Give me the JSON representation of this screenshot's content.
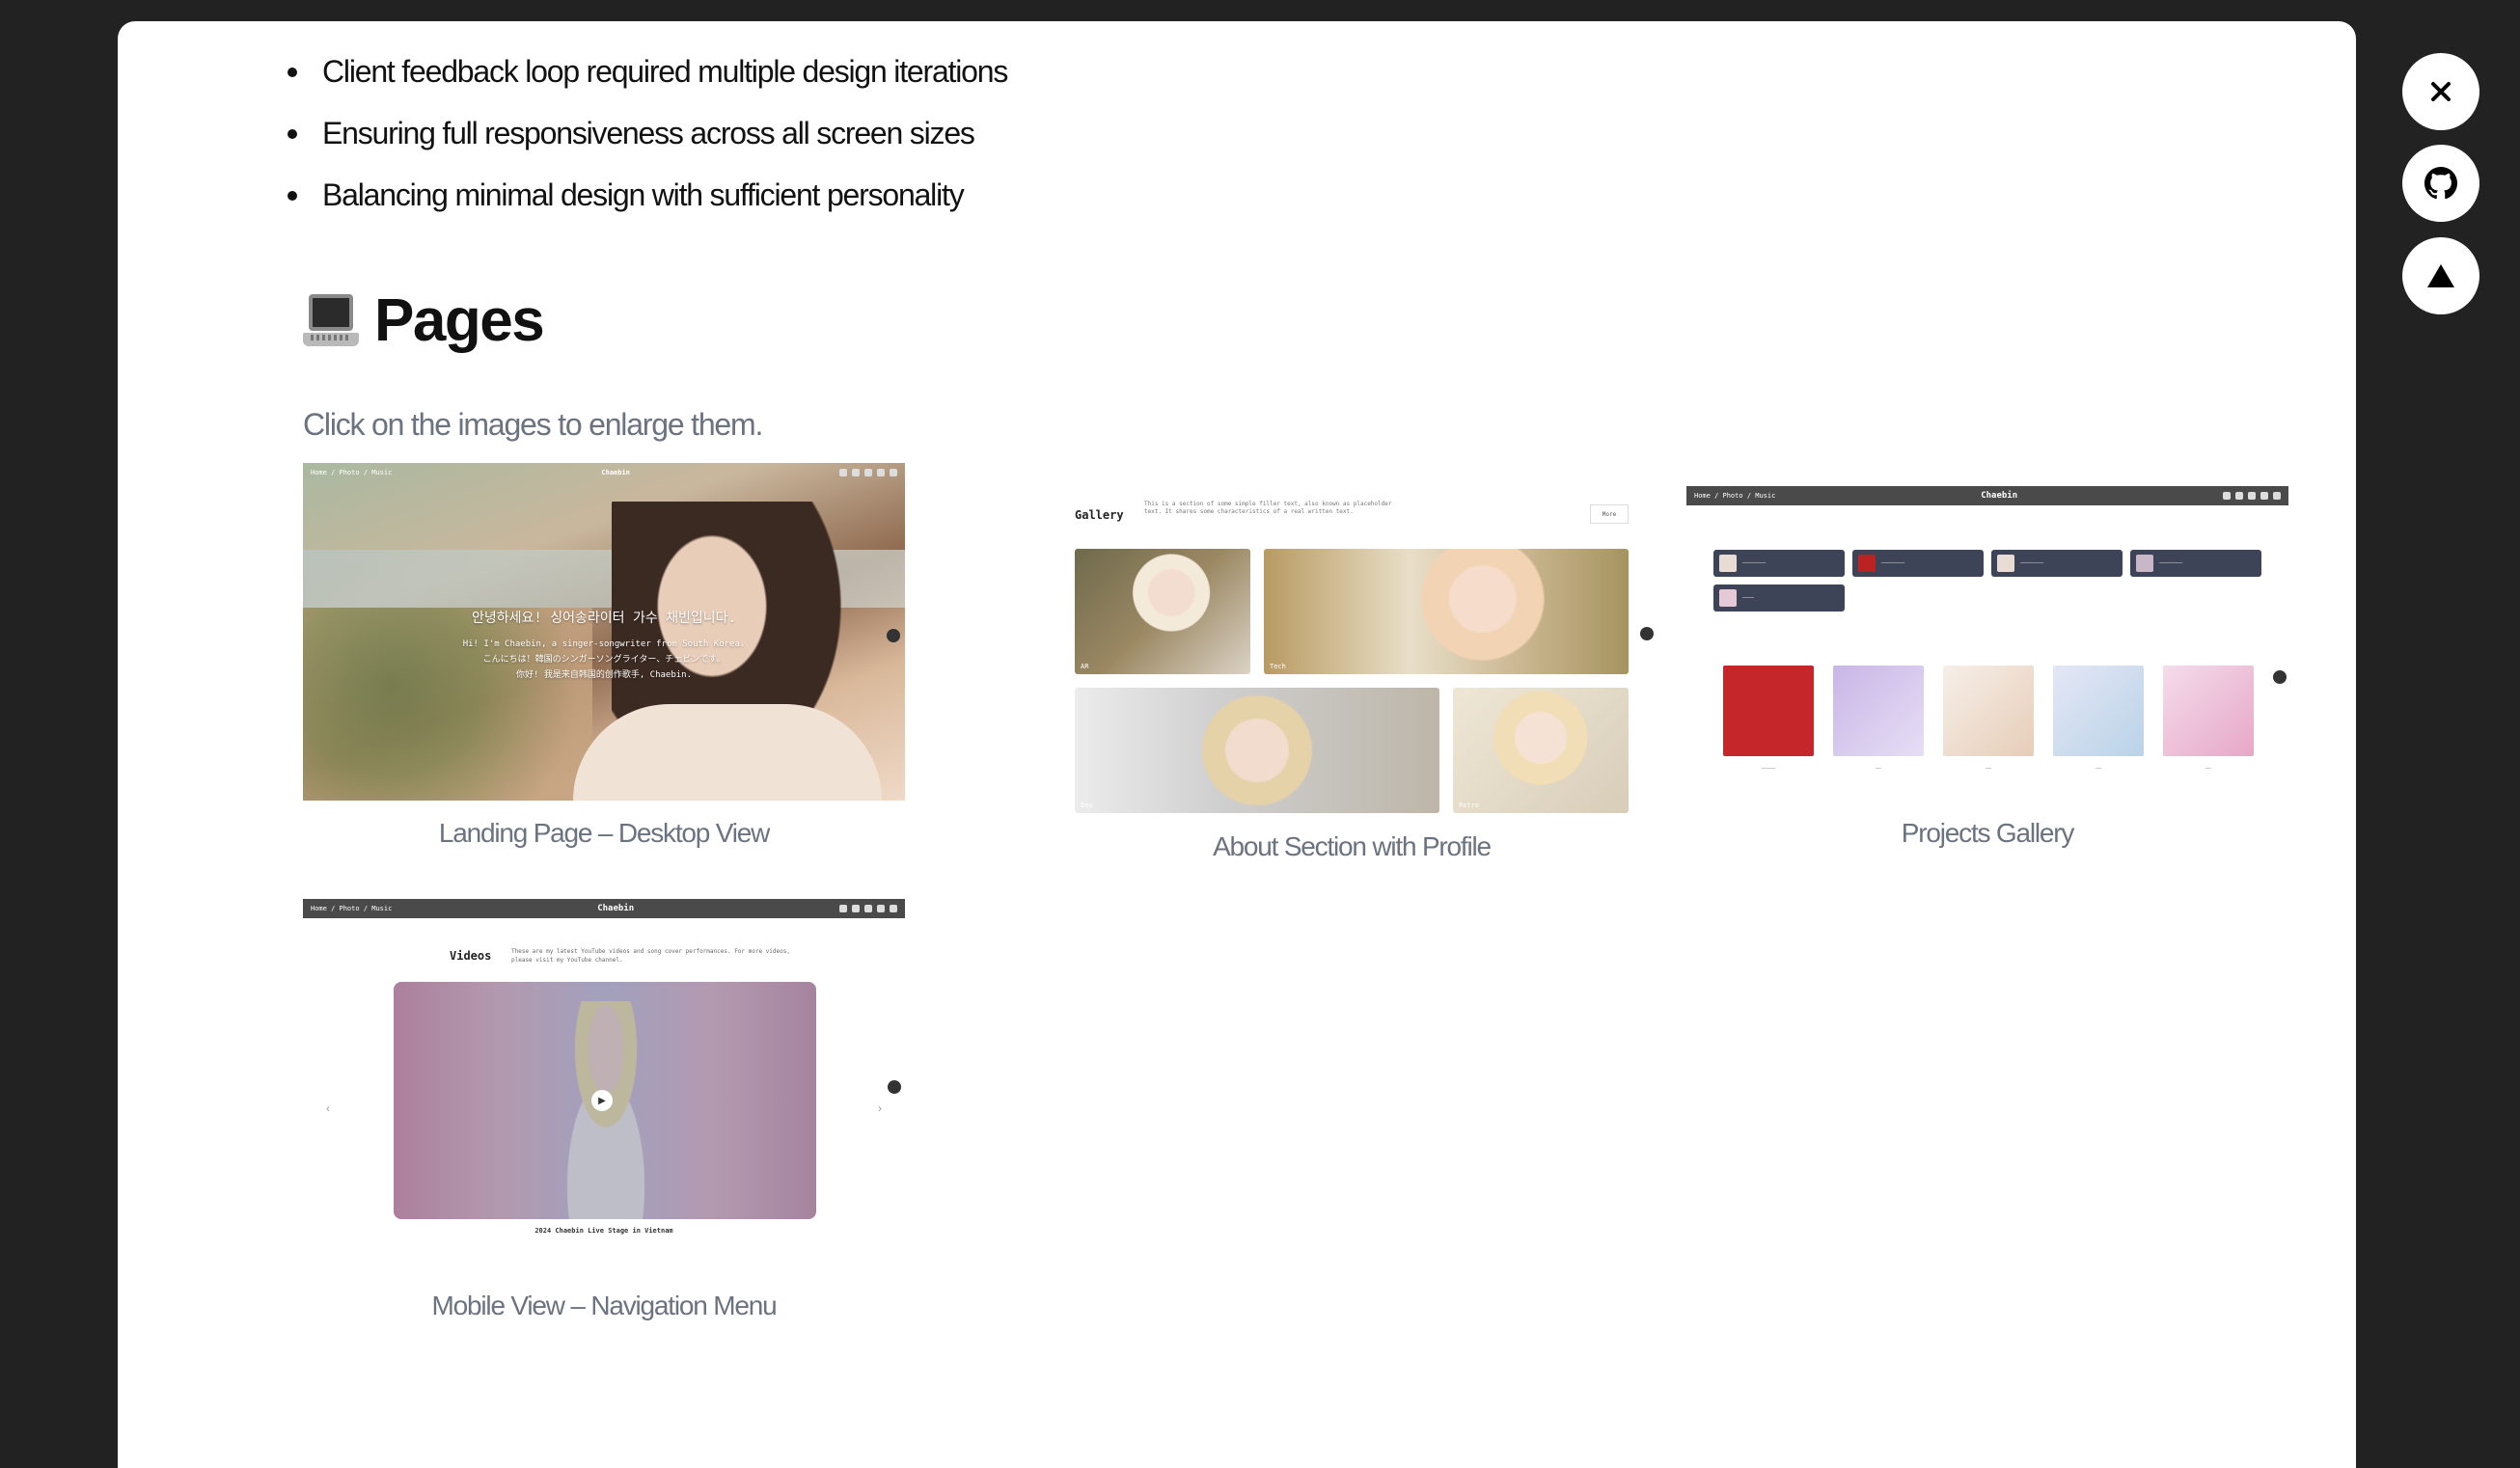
{
  "bullets": [
    "Client feedback loop required multiple design iterations",
    "Ensuring full responsiveness across all screen sizes",
    "Balancing minimal design with sufficient personality"
  ],
  "section": {
    "title": "Pages",
    "hint": "Click on the images to enlarge them."
  },
  "cards": [
    {
      "caption": "Landing Page – Desktop View",
      "nav": [
        "Home",
        "/ Photo",
        "/ Music"
      ],
      "brand": "Chaebin",
      "greeting": "안녕하세요! 싱어송라이터 가수 채빈입니다.",
      "intro_lines": [
        "Hi! I'm Chaebin, a singer-songwriter from South Korea.",
        "こんにちは！韓国のシンガーソングライター、チェビンです。",
        "你好! 我是来自韩国的创作歌手, Chaebin."
      ]
    },
    {
      "caption": "About Section with Profile",
      "title": "Gallery",
      "description": "This is a section of some simple filler text, also known as placeholder text. It shares some characteristics of a real written text.",
      "more": "More",
      "tags": [
        "AR",
        "Tech",
        "Dev",
        "Retro"
      ]
    },
    {
      "caption": "Projects Gallery",
      "nav": [
        "Home",
        "/ Photo",
        "/ Music"
      ],
      "brand": "Chaebin"
    },
    {
      "caption": "Mobile View – Navigation Menu",
      "nav": [
        "Home",
        "/ Photo",
        "/ Music"
      ],
      "brand": "Chaebin",
      "title": "Videos",
      "description": "These are my latest YouTube videos and song cover performances. For more videos, please visit my YouTube channel.",
      "video_caption": "2024 Chaebin Live Stage in Vietnam"
    }
  ],
  "side_buttons": {
    "close_icon": "close-icon",
    "github_icon": "github-icon",
    "top_icon": "arrow-up-icon"
  }
}
